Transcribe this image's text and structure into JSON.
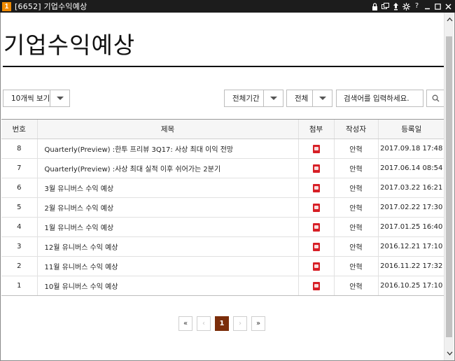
{
  "window": {
    "badge": "1",
    "title": "[6652] 기업수익예상"
  },
  "page": {
    "title": "기업수익예상"
  },
  "toolbar": {
    "page_size_label": "10개씩 보기",
    "period_label": "전체기간",
    "category_label": "전체",
    "search_placeholder": "검색어를 입력하세요."
  },
  "table": {
    "headers": {
      "no": "번호",
      "title": "제목",
      "attachment": "첨부",
      "author": "작성자",
      "date": "등록일"
    },
    "rows": [
      {
        "no": "8",
        "title": "Quarterly(Preview) :한투 프리뷰 3Q17: 사상 최대 이익 전망",
        "author": "안혁",
        "date": "2017.09.18 17:48"
      },
      {
        "no": "7",
        "title": "Quarterly(Preview) :사상 최대 실적 이후 쉬어가는 2분기",
        "author": "안혁",
        "date": "2017.06.14 08:54"
      },
      {
        "no": "6",
        "title": "3월 유니버스 수익 예상",
        "author": "안혁",
        "date": "2017.03.22 16:21"
      },
      {
        "no": "5",
        "title": "2월 유니버스 수익 예상",
        "author": "안혁",
        "date": "2017.02.22 17:30"
      },
      {
        "no": "4",
        "title": "1월 유니버스 수익 예상",
        "author": "안혁",
        "date": "2017.01.25 16:40"
      },
      {
        "no": "3",
        "title": "12월 유니버스 수익 예상",
        "author": "안혁",
        "date": "2016.12.21 17:10"
      },
      {
        "no": "2",
        "title": "11월 유니버스 수익 예상",
        "author": "안혁",
        "date": "2016.11.22 17:32"
      },
      {
        "no": "1",
        "title": "10월 유니버스 수익 예상",
        "author": "안혁",
        "date": "2016.10.25 17:10"
      }
    ]
  },
  "pagination": {
    "first": "«",
    "prev": "‹",
    "current": "1",
    "next": "›",
    "last": "»"
  },
  "colors": {
    "titlebar_bg": "#1c1c1c",
    "badge": "#f08a00",
    "active_page": "#7b2d0a",
    "pdf_icon": "#d71f26"
  }
}
